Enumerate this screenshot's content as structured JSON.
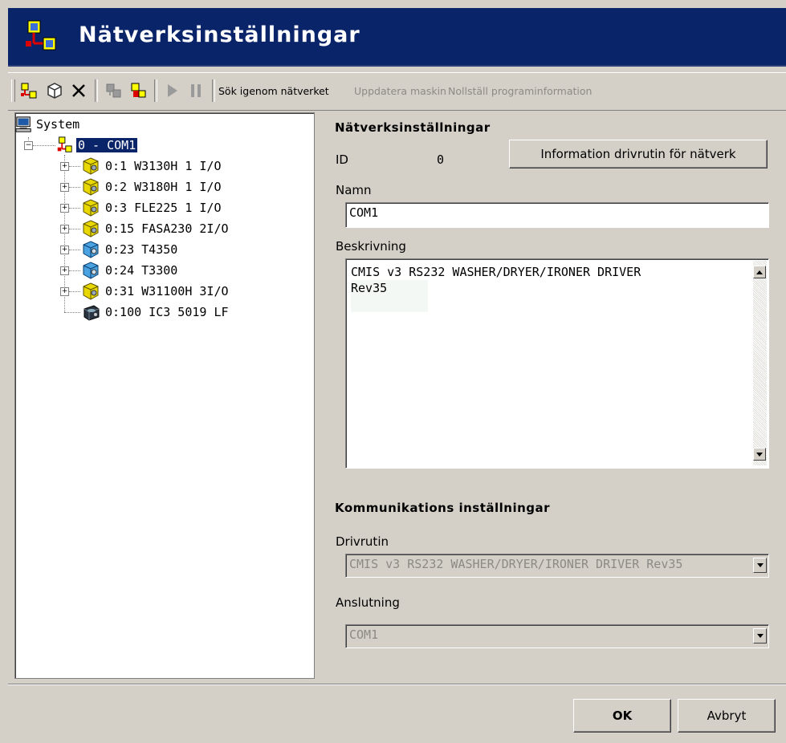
{
  "window": {
    "title": "Nätverksinställningar"
  },
  "toolbar": {
    "icons": [
      "add-network-icon",
      "add-machine-icon",
      "delete-icon",
      "machine-settings-icon",
      "machine-program-icon",
      "play-icon",
      "pause-icon"
    ],
    "search_network": "Sök igenom nätverket",
    "update_machine": "Uppdatera maskin",
    "reset_program_info": "Nollställ programinformation"
  },
  "tree": {
    "root": "System",
    "network": "0 - COM1",
    "nodes": [
      {
        "label": "0:1 W3130H 1 I/O",
        "icon": "yellow-machine-icon",
        "expandable": true
      },
      {
        "label": "0:2 W3180H 1 I/O",
        "icon": "yellow-machine-icon",
        "expandable": true
      },
      {
        "label": "0:3 FLE225 1 I/O",
        "icon": "yellow-machine-icon",
        "expandable": true
      },
      {
        "label": "0:15 FASA230 2I/O",
        "icon": "yellow-machine-icon",
        "expandable": true
      },
      {
        "label": "0:23 T4350",
        "icon": "blue-machine-icon",
        "expandable": true
      },
      {
        "label": "0:24 T3300",
        "icon": "blue-machine-icon",
        "expandable": true
      },
      {
        "label": "0:31 W31100H 3I/O",
        "icon": "yellow-machine-icon",
        "expandable": true
      },
      {
        "label": "0:100 IC3 5019 LF",
        "icon": "ironer-icon",
        "expandable": false
      }
    ]
  },
  "settings": {
    "section_title": "Nätverksinställningar",
    "id_label": "ID",
    "id_value": "0",
    "driver_info_button": "Information drivrutin för nätverk",
    "name_label": "Namn",
    "name_value": "COM1",
    "description_label": "Beskrivning",
    "description_line1": "CMIS v3 RS232 WASHER/DRYER/IRONER DRIVER",
    "description_line2": "Rev35"
  },
  "communication": {
    "section_title": "Kommunikations inställningar",
    "driver_label": "Drivrutin",
    "driver_value": "CMIS v3 RS232 WASHER/DRYER/IRONER DRIVER Rev35",
    "connection_label": "Anslutning",
    "connection_value": "COM1"
  },
  "footer": {
    "ok": "OK",
    "cancel": "Avbryt"
  },
  "colors": {
    "titlebar": "#0a246a",
    "face": "#d4d0c8",
    "selection": "#0a246a"
  }
}
